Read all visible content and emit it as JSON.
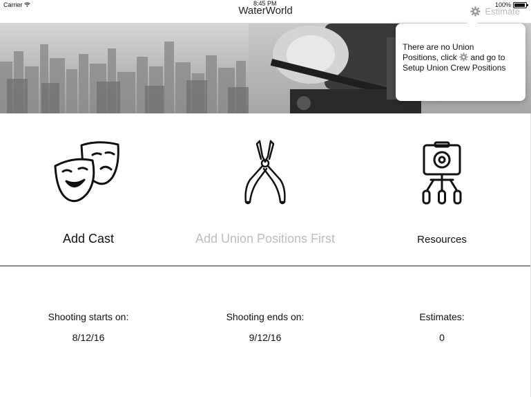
{
  "status_bar": {
    "carrier": "Carrier",
    "time": "8:45 PM",
    "battery": "100%"
  },
  "nav": {
    "title": "WaterWorld",
    "estimate_label": "Estimate"
  },
  "popover": {
    "line1": "There are no Union",
    "line2_before": "Positions, click",
    "line2_after": "and go to",
    "line3": "Setup Union Crew Positions"
  },
  "tiles": {
    "cast": {
      "label": "Add Cast",
      "icon": "theater-masks-icon"
    },
    "union": {
      "label": "Add Union Positions First",
      "icon": "pliers-icon"
    },
    "resources": {
      "label": "Resources",
      "icon": "camera-tripod-icon"
    }
  },
  "info": {
    "start": {
      "label": "Shooting starts on:",
      "value": "8/12/16"
    },
    "end": {
      "label": "Shooting ends on:",
      "value": "9/12/16"
    },
    "estimates": {
      "label": "Estimates:",
      "value": "0"
    }
  },
  "colors": {
    "disabled_text": "#bdbdbd",
    "divider": "#222222"
  }
}
